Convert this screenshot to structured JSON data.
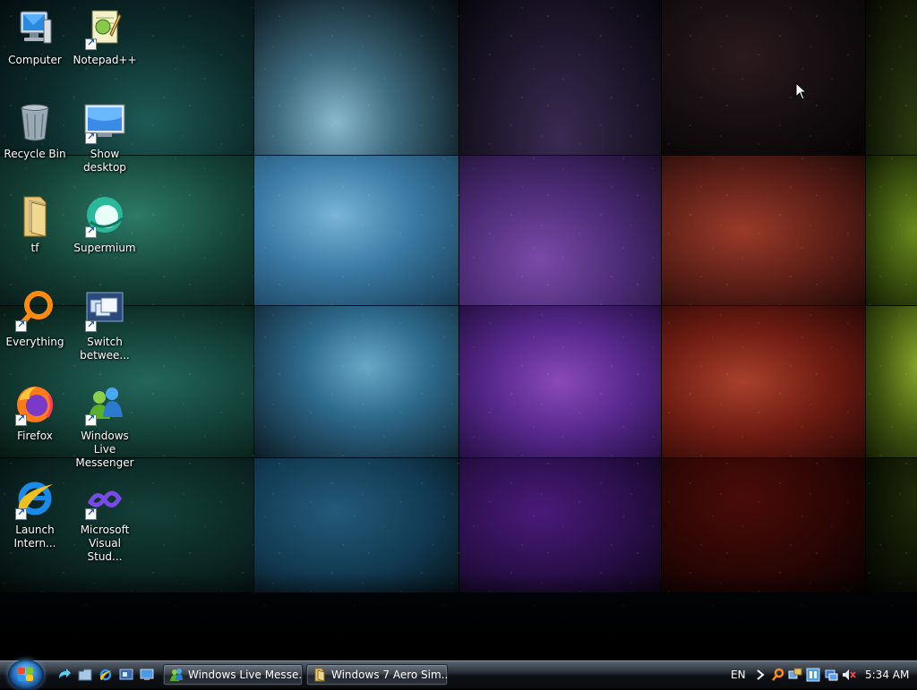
{
  "desktop": {
    "icons": [
      {
        "label": "Computer",
        "icon": "computer-icon",
        "shortcut": false
      },
      {
        "label": "Notepad++",
        "icon": "notepadpp-icon",
        "shortcut": true
      },
      {
        "label": "Recycle Bin",
        "icon": "recycle-bin-icon",
        "shortcut": false
      },
      {
        "label": "Show desktop",
        "icon": "show-desktop-icon",
        "shortcut": true
      },
      {
        "label": "tf",
        "icon": "folder-icon",
        "shortcut": false
      },
      {
        "label": "Supermium",
        "icon": "supermium-icon",
        "shortcut": true
      },
      {
        "label": "Everything",
        "icon": "everything-icon",
        "shortcut": true
      },
      {
        "label": "Switch\nbetwee...",
        "icon": "switch-windows-icon",
        "shortcut": true
      },
      {
        "label": "Firefox",
        "icon": "firefox-icon",
        "shortcut": true
      },
      {
        "label": "Windows Live\nMessenger",
        "icon": "messenger-icon",
        "shortcut": true
      },
      {
        "label": "Launch\nIntern...",
        "icon": "internet-explorer-icon",
        "shortcut": true
      },
      {
        "label": "Microsoft\nVisual Stud...",
        "icon": "visual-studio-icon",
        "shortcut": true
      }
    ]
  },
  "taskbar": {
    "start_icon": "windows-start-orb-icon",
    "quick_launch": [
      "switch-windows-icon",
      "folder-icon",
      "internet-explorer-icon",
      "media-icon",
      "show-desktop-icon"
    ],
    "tasks": [
      {
        "label": "Windows Live Messe...",
        "icon": "messenger-icon"
      },
      {
        "label": "Windows 7 Aero Sim...",
        "icon": "folder-icon"
      }
    ],
    "tray": {
      "language": "EN",
      "expand_icon": "chevron-right-icon",
      "icons": [
        "everything-search-icon",
        "network-icon",
        "tray-app-icon",
        "sync-icon",
        "volume-muted-icon"
      ],
      "clock": "5:34 AM"
    }
  },
  "colors": {
    "taskbar_top": "#5a6470",
    "taskbar_bottom": "#0a0c10",
    "accent_blue": "#2a78c8"
  }
}
